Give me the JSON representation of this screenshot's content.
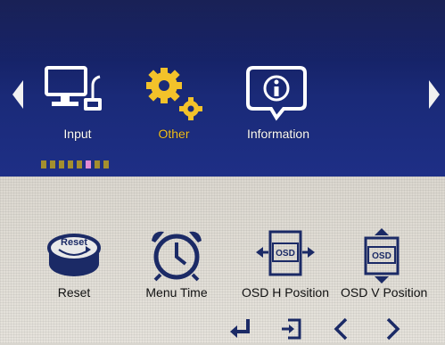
{
  "top_menu": {
    "tabs": [
      {
        "label": "Input",
        "icon": "monitor-input-icon",
        "selected": false
      },
      {
        "label": "Other",
        "icon": "gears-icon",
        "selected": true
      },
      {
        "label": "Information",
        "icon": "info-speech-icon",
        "selected": false
      }
    ],
    "page_indicator": {
      "count": 8,
      "active_index": 5
    }
  },
  "items": [
    {
      "label": "Reset",
      "icon": "reset-icon",
      "icon_text": "Reset"
    },
    {
      "label": "Menu Time",
      "icon": "alarm-clock-icon"
    },
    {
      "label": "OSD H Position",
      "icon": "osd-h-position-icon",
      "icon_text": "OSD"
    },
    {
      "label": "OSD V Position",
      "icon": "osd-v-position-icon",
      "icon_text": "OSD"
    }
  ],
  "nav_keys": [
    "enter-icon",
    "exit-icon",
    "left-icon",
    "right-icon"
  ],
  "colors": {
    "top_band": "#1a2a78",
    "selected_label": "#f3c22a",
    "icon_navy": "#1b2a66",
    "page_dot": "#a48f2e",
    "page_dot_active": "#e38ad4"
  }
}
